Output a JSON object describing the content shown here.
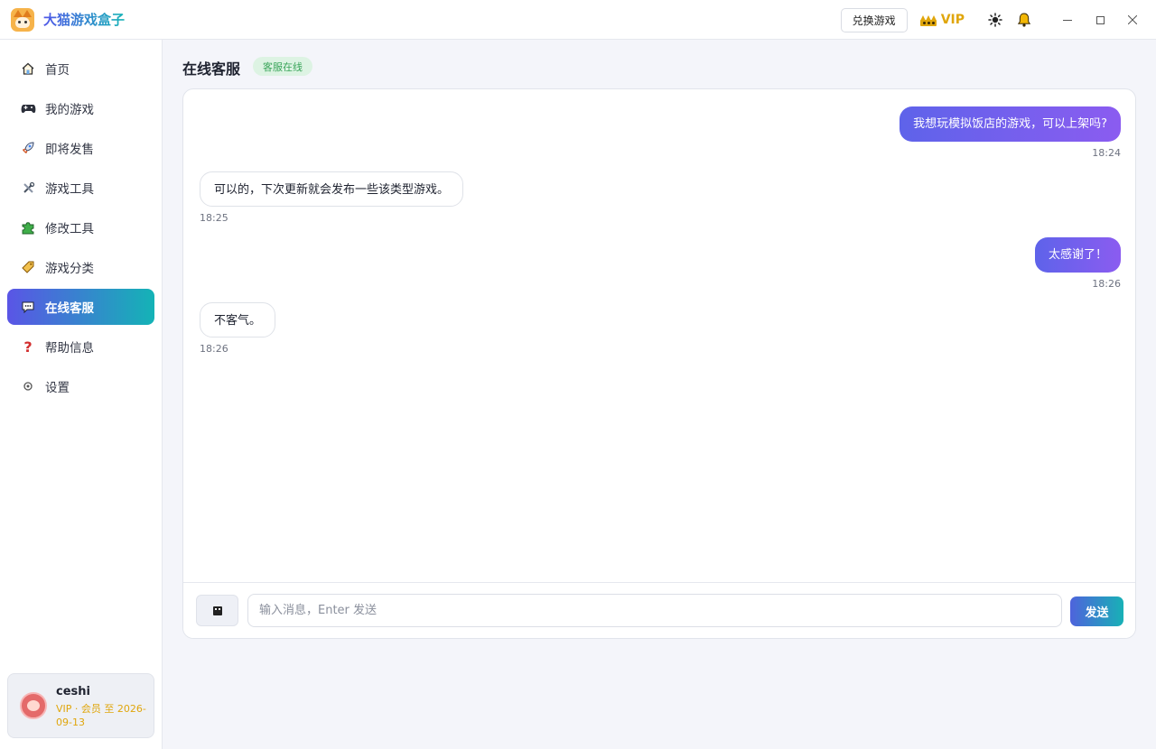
{
  "app": {
    "title": "大猫游戏盒子"
  },
  "titlebar": {
    "redeem_label": "兑换游戏",
    "vip_label": "VIP",
    "icons": [
      "crown-icon",
      "sun-icon",
      "bell-icon",
      "minimize-icon",
      "maximize-icon",
      "close-icon"
    ]
  },
  "sidebar": {
    "items": [
      {
        "label": "首页",
        "icon": "home-icon"
      },
      {
        "label": "我的游戏",
        "icon": "gamepad-icon"
      },
      {
        "label": "即将发售",
        "icon": "rocket-icon"
      },
      {
        "label": "游戏工具",
        "icon": "tools-icon"
      },
      {
        "label": "修改工具",
        "icon": "puzzle-icon"
      },
      {
        "label": "游戏分类",
        "icon": "tag-icon"
      },
      {
        "label": "在线客服",
        "icon": "chat-icon",
        "active": true
      },
      {
        "label": "帮助信息",
        "icon": "question-icon"
      },
      {
        "label": "设置",
        "icon": "gear-icon"
      }
    ]
  },
  "user": {
    "name": "ceshi",
    "membership": "VIP · 会员 至 2026-09-13"
  },
  "page": {
    "title": "在线客服",
    "status_badge": "客服在线"
  },
  "messages": [
    {
      "from": "me",
      "text": "我想玩模拟饭店的游戏，可以上架吗?",
      "time": "18:24"
    },
    {
      "from": "them",
      "text": "可以的，下次更新就会发布一些该类型游戏。",
      "time": "18:25"
    },
    {
      "from": "me",
      "text": "太感谢了！",
      "time": "18:26"
    },
    {
      "from": "them",
      "text": "不客气。",
      "time": "18:26"
    }
  ],
  "composer": {
    "placeholder": "输入消息，Enter 发送",
    "value": "",
    "send_label": "发送"
  },
  "colors": {
    "accent_start": "#5a55e6",
    "accent_end": "#14b3b6",
    "vip": "#e0a60c",
    "online": "#3aa55a"
  }
}
